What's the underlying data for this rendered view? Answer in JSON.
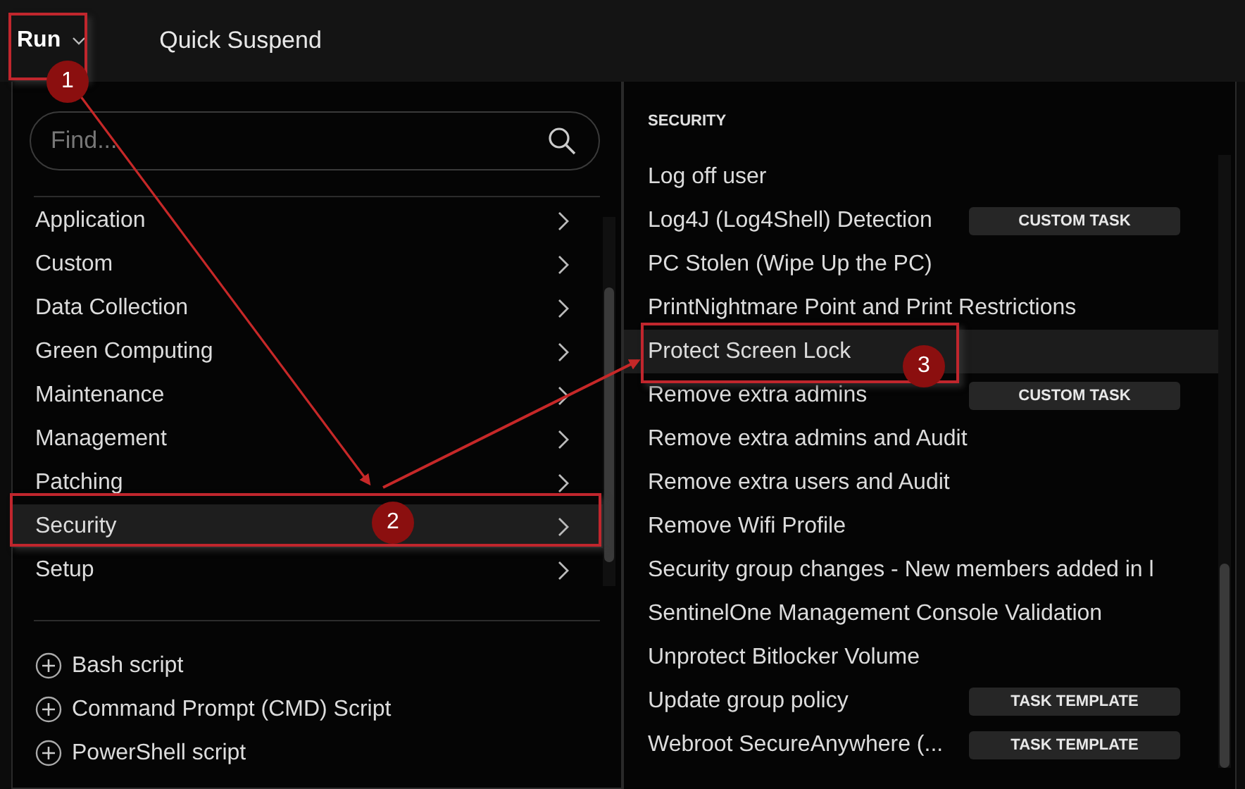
{
  "toolbar": {
    "run_button": "Run",
    "quick_suspend": "Quick Suspend"
  },
  "menu": {
    "search": {
      "placeholder": "Find..."
    },
    "categories": [
      {
        "label": "Application",
        "selected": false
      },
      {
        "label": "Custom",
        "selected": false
      },
      {
        "label": "Data Collection",
        "selected": false
      },
      {
        "label": "Green Computing",
        "selected": false
      },
      {
        "label": "Maintenance",
        "selected": false
      },
      {
        "label": "Management",
        "selected": false
      },
      {
        "label": "Patching",
        "selected": false
      },
      {
        "label": "Security",
        "selected": true
      },
      {
        "label": "Setup",
        "selected": false
      }
    ],
    "script_actions": [
      "Bash script",
      "Command Prompt (CMD) Script",
      "PowerShell script"
    ]
  },
  "submenu": {
    "heading": "SECURITY",
    "items": [
      {
        "label": "Log off user",
        "highlighted": false
      },
      {
        "label": "Log4J (Log4Shell) Detection",
        "highlighted": false,
        "badge": "CUSTOM TASK"
      },
      {
        "label": "PC Stolen (Wipe Up the PC)",
        "highlighted": false
      },
      {
        "label": "PrintNightmare Point and Print Restrictions",
        "highlighted": false
      },
      {
        "label": "Protect Screen Lock",
        "highlighted": true
      },
      {
        "label": "Remove extra admins",
        "highlighted": false,
        "badge": "CUSTOM TASK"
      },
      {
        "label": "Remove extra admins and Audit",
        "highlighted": false
      },
      {
        "label": "Remove extra users and Audit",
        "highlighted": false
      },
      {
        "label": "Remove Wifi Profile",
        "highlighted": false
      },
      {
        "label": "Security group changes - New members added in l",
        "highlighted": false
      },
      {
        "label": "SentinelOne Management Console Validation",
        "highlighted": false
      },
      {
        "label": "Unprotect Bitlocker Volume",
        "highlighted": false
      },
      {
        "label": "Update group policy",
        "highlighted": false,
        "badge": "TASK TEMPLATE"
      },
      {
        "label": "Webroot SecureAnywhere (...",
        "highlighted": false,
        "badge": "TASK TEMPLATE"
      }
    ]
  },
  "callouts": [
    {
      "label": "1"
    },
    {
      "label": "2"
    },
    {
      "label": "3"
    }
  ]
}
